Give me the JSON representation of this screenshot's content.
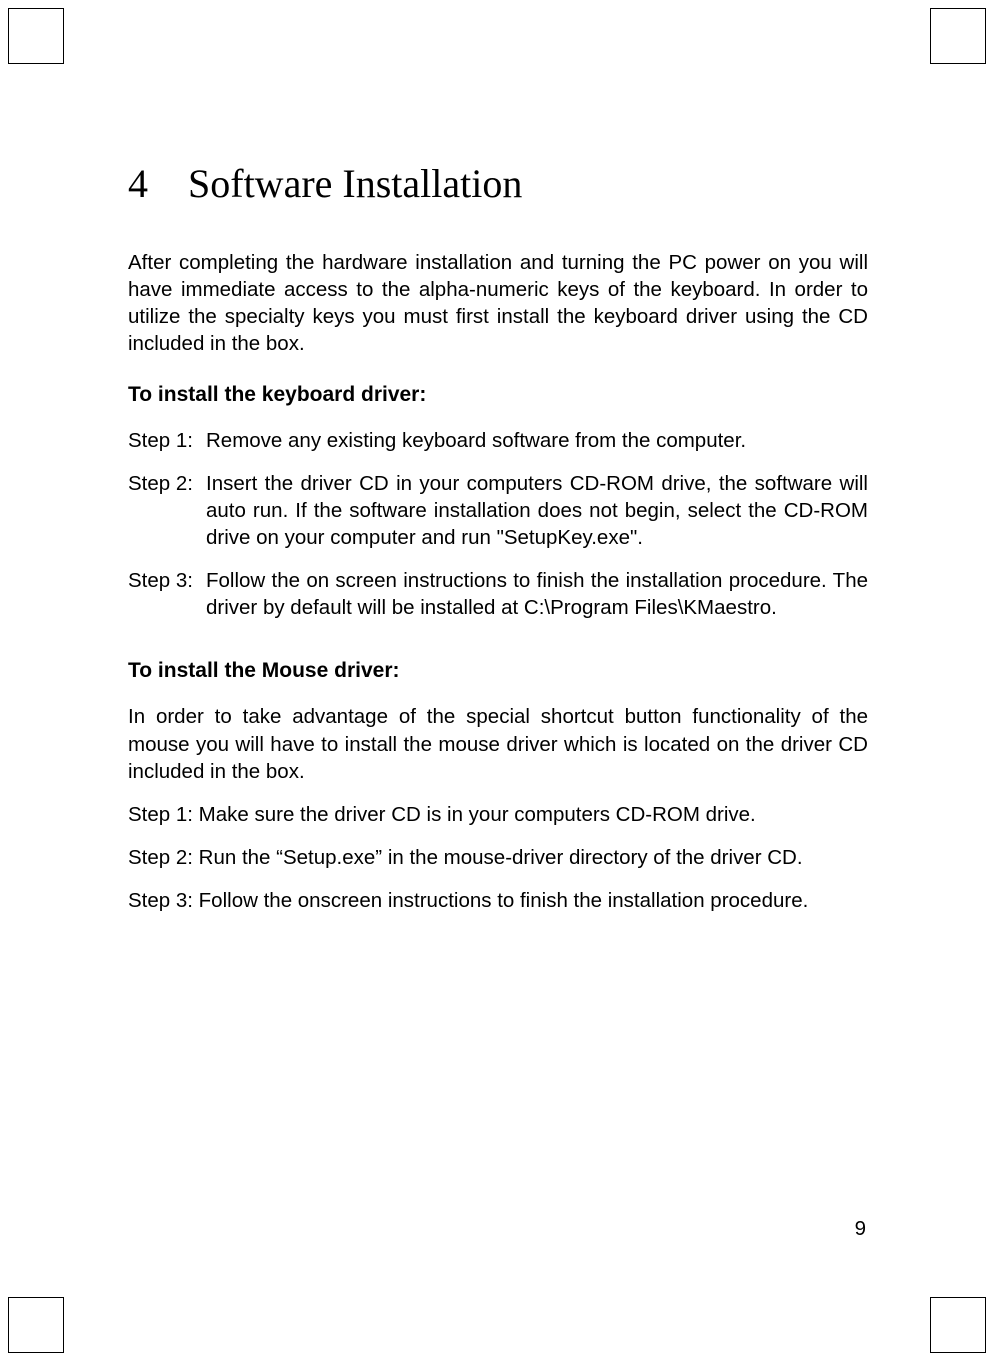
{
  "chapter": {
    "number": "4",
    "title": "Software Installation"
  },
  "intro": "After completing the hardware installation and turning the PC power on you will have immediate access to the alpha-numeric keys of the keyboard.   In order to utilize the specialty keys you must first install the keyboard driver using the CD included in the box.",
  "section_keyboard": {
    "heading": "To install the keyboard driver:",
    "steps": [
      {
        "label": "Step 1:",
        "text": "Remove any existing keyboard software from the computer."
      },
      {
        "label": "Step 2:",
        "text": "Insert the driver CD in your computers CD-ROM drive, the software will auto run. If the software installation does not begin, select the CD-ROM drive on your computer and run \"SetupKey.exe\"."
      },
      {
        "label": "Step 3:",
        "text": "Follow the on screen instructions to finish the installation procedure. The driver by default will be installed at C:\\Program Files\\KMaestro."
      }
    ]
  },
  "section_mouse": {
    "heading": "To install the Mouse driver:",
    "intro": "In order to take advantage of the special shortcut button functionality of the mouse you will have to install the mouse driver which is located on the driver CD included in the box.",
    "steps": [
      {
        "label": "Step 1:  Make sure the driver CD is in your computers CD-ROM drive."
      },
      {
        "label": "Step 2: Run the “Setup.exe” in the mouse-driver directory of the driver CD."
      },
      {
        "label": "Step 3: Follow the onscreen instructions to finish the installation procedure."
      }
    ]
  },
  "page_number": "9"
}
